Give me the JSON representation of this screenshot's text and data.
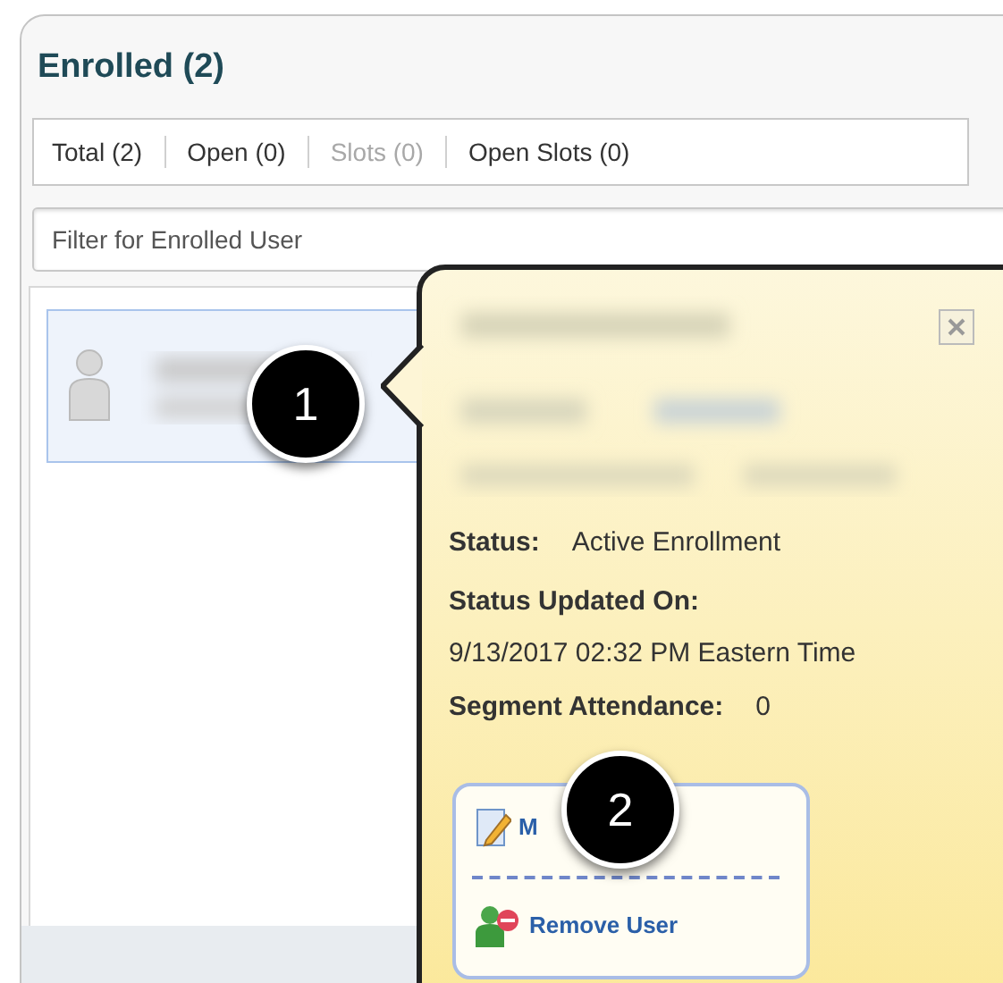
{
  "panel": {
    "title": "Enrolled (2)"
  },
  "tabs": [
    {
      "label": "Total (2)",
      "disabled": false
    },
    {
      "label": "Open (0)",
      "disabled": false
    },
    {
      "label": "Slots (0)",
      "disabled": true
    },
    {
      "label": "Open Slots (0)",
      "disabled": false
    }
  ],
  "filter": {
    "placeholder": "Filter for Enrolled User"
  },
  "enrolled_users": [
    {
      "selected": true
    }
  ],
  "popup": {
    "fields": [
      {
        "label": "Status:",
        "value": "Active Enrollment",
        "kind": "inline"
      },
      {
        "label": "Status Updated On:",
        "value": "9/13/2017 02:32 PM Eastern Time",
        "kind": "stacked"
      },
      {
        "label": "Segment Attendance:",
        "value": "0",
        "kind": "inline"
      }
    ],
    "actions": [
      {
        "label": "M",
        "kind": "edit"
      },
      {
        "label": "Remove User",
        "kind": "remove"
      }
    ]
  },
  "callouts": [
    "1",
    "2"
  ]
}
